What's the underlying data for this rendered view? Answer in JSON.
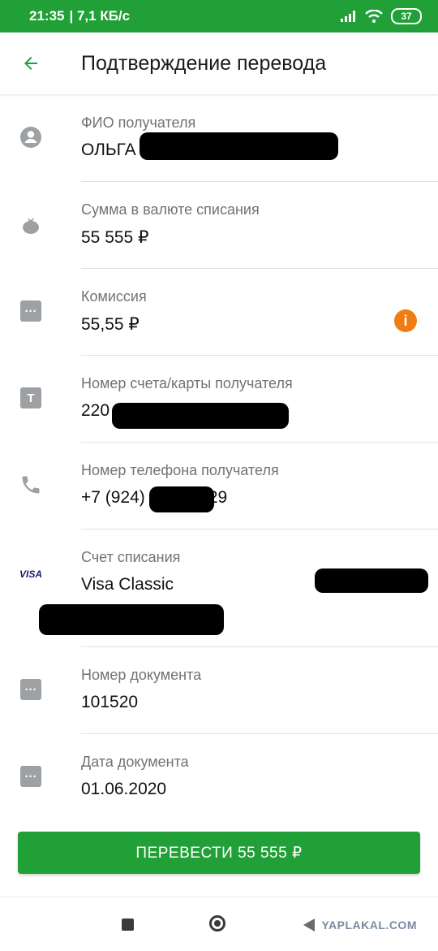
{
  "status": {
    "time": "21:35",
    "speed": "| 7,1 КБ/с",
    "battery": "37"
  },
  "toolbar": {
    "title": "Подтверждение перевода"
  },
  "rows": [
    {
      "label": "ФИО получателя",
      "value": "ОЛЬГА"
    },
    {
      "label": "Сумма в валюте списания",
      "value": "55 555 ₽"
    },
    {
      "label": "Комиссия",
      "value": "55,55 ₽"
    },
    {
      "label": "Номер счета/карты получателя",
      "value": "220"
    },
    {
      "label": "Номер телефона получателя",
      "value_prefix": "+7 (924)",
      "value_suffix": "29"
    },
    {
      "label": "Счет списания",
      "value": "Visa Classic"
    },
    {
      "label": "Номер документа",
      "value": "101520"
    },
    {
      "label": "Дата документа",
      "value": "01.06.2020"
    }
  ],
  "icons": {
    "text_badge": "T",
    "info": "i",
    "visa": "VISA"
  },
  "cta": {
    "label": "ПЕРЕВЕСТИ 55 555 ₽"
  },
  "watermark": "YAPLAKAL.COM",
  "colors": {
    "brand": "#21a038",
    "info": "#f07d13"
  }
}
